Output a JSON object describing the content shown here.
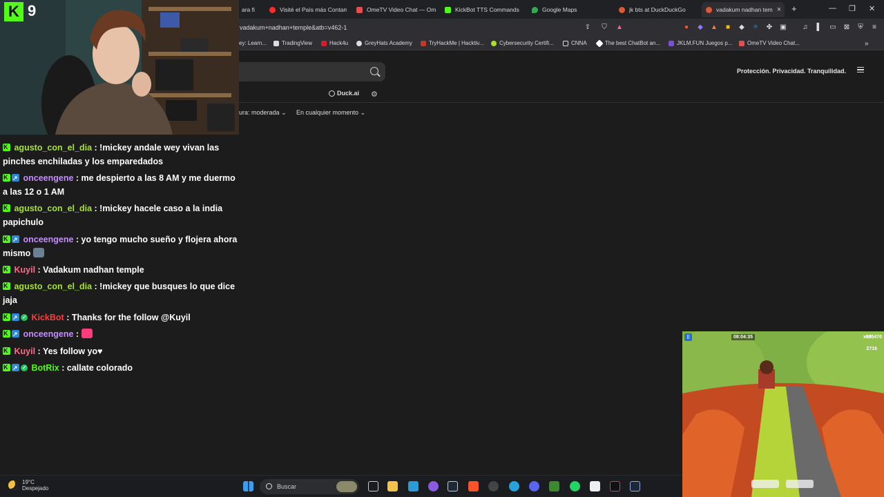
{
  "browser": {
    "tabs": [
      {
        "label": "ara fi",
        "color": "#888888",
        "active": false
      },
      {
        "label": "Visité el País más Contam",
        "color": "#ff2a2a",
        "active": false
      },
      {
        "label": "OmeTV Video Chat — Om",
        "color": "#e05050",
        "active": false
      },
      {
        "label": "KickBot TTS Commands",
        "color": "#53fc18",
        "active": false
      },
      {
        "label": "Google Maps",
        "color": "#34a853",
        "active": false
      },
      {
        "label": "jk bts at DuckDuckGo",
        "color": "#de5833",
        "active": false
      },
      {
        "label": "vadakum nadhan tem",
        "color": "#de5833",
        "active": true
      }
    ],
    "new_tab_label": "+",
    "url": "vadakum+nadhan+temple&atb=v462-1",
    "bookmarks": [
      {
        "label": "ey: Learn...",
        "color": "#888888"
      },
      {
        "label": "TradingView",
        "color": "#dddddd"
      },
      {
        "label": "Hack4u",
        "color": "#d02030"
      },
      {
        "label": "GreyHats Academy",
        "color": "#dddddd"
      },
      {
        "label": "TryHackMe | Hacktiv...",
        "color": "#c0392b"
      },
      {
        "label": "Cybersecurity Certifi...",
        "color": "#a6e22e"
      },
      {
        "label": "CNNA",
        "color": "#dddddd"
      },
      {
        "label": "The best ChatBot an...",
        "color": "#ffffff"
      },
      {
        "label": "JKLM.FUN Juegos p...",
        "color": "#7b4fd6"
      },
      {
        "label": "OmeTV Video Chat...",
        "color": "#e05050"
      }
    ]
  },
  "ddg": {
    "tagline": "Protección. Privacidad. Tranquilidad.",
    "duckai_label": "Duck.ai",
    "filter_safe": "ura: moderada",
    "filter_time": "En cualquier momento"
  },
  "stream": {
    "logo_letter": "K",
    "viewer_count": "9"
  },
  "chat": [
    {
      "user": "agusto_con_el_dia",
      "color": "#a6e22e",
      "badges": [
        "k"
      ],
      "text": ": !mickey andale wey vivan las pinches enchiladas y los emparedados"
    },
    {
      "user": "onceengene",
      "color": "#c38cff",
      "badges": [
        "k",
        "boost"
      ],
      "text": ": me despierto a las 8 AM y me duermo a las 12 o 1 AM"
    },
    {
      "user": "agusto_con_el_dia",
      "color": "#a6e22e",
      "badges": [
        "k"
      ],
      "text": ": !mickey hacele caso a la india papichulo"
    },
    {
      "user": "onceengene",
      "color": "#c38cff",
      "badges": [
        "k",
        "boost"
      ],
      "text": ": yo tengo mucho sueño y flojera ahora mismo"
    },
    {
      "user": "Kuyil",
      "color": "#ff6b8b",
      "badges": [
        "k"
      ],
      "text": ": Vadakum nadhan temple"
    },
    {
      "user": "agusto_con_el_dia",
      "color": "#a6e22e",
      "badges": [
        "k"
      ],
      "text": ": !mickey que busques lo que dice jaja"
    },
    {
      "user": "KickBot",
      "color": "#ff3b3b",
      "badges": [
        "k",
        "boost",
        "check"
      ],
      "text": ": Thanks for the follow @Kuyil"
    },
    {
      "user": "onceengene",
      "color": "#c38cff",
      "badges": [
        "k",
        "boost"
      ],
      "text": ":"
    },
    {
      "user": "Kuyil",
      "color": "#ff6b8b",
      "badges": [
        "k"
      ],
      "text": ": Yes follow yo♥"
    },
    {
      "user": "BotRix",
      "color": "#53fc18",
      "badges": [
        "k",
        "boost",
        "check"
      ],
      "text": ": callate colorado"
    }
  ],
  "game": {
    "timer": "08:04:35",
    "score": "655470",
    "multiplier": "x30",
    "coins": "2716"
  },
  "taskbar": {
    "temp": "19°C",
    "weather": "Despejado",
    "search_placeholder": "Buscar"
  }
}
